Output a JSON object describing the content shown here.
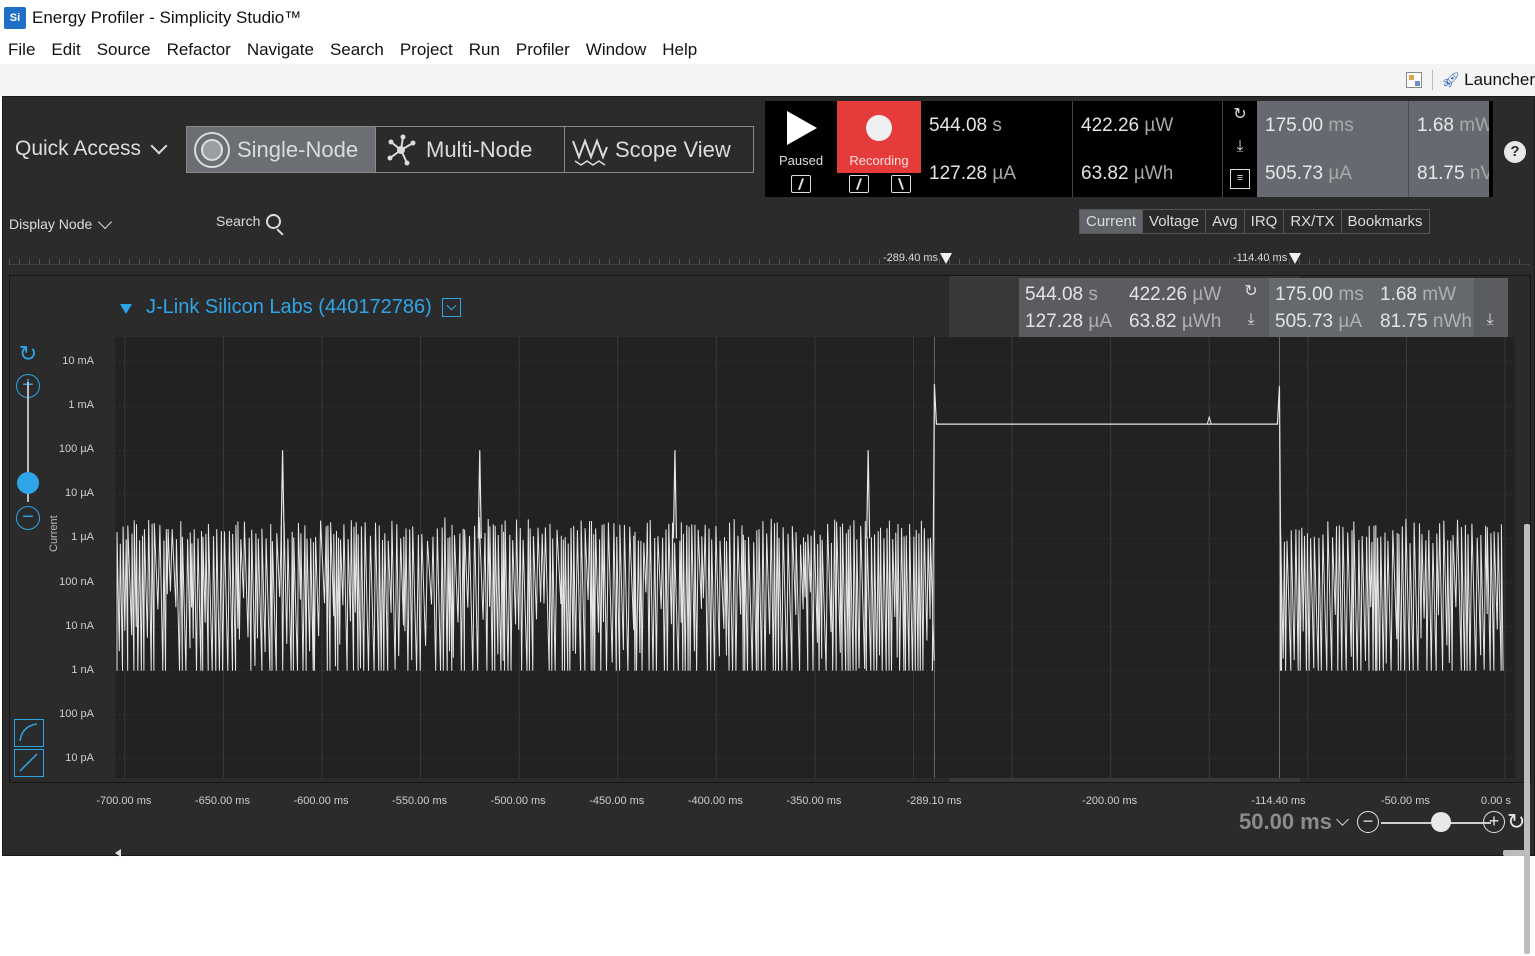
{
  "window": {
    "app_icon": "Si",
    "title": "Energy Profiler - Simplicity Studio™"
  },
  "menu": {
    "items": [
      "File",
      "Edit",
      "Source",
      "Refactor",
      "Navigate",
      "Search",
      "Project",
      "Run",
      "Profiler",
      "Window",
      "Help"
    ]
  },
  "toolbar": {
    "launcher_label": "Launcher",
    "icons": [
      "perspective-icon",
      "rocket-icon"
    ]
  },
  "profiler": {
    "quick_access": "Quick Access",
    "modes": [
      {
        "label": "Single-Node",
        "icon": "single-node-icon",
        "active": true
      },
      {
        "label": "Multi-Node",
        "icon": "multi-node-icon",
        "active": false
      },
      {
        "label": "Scope View",
        "icon": "scope-view-icon",
        "active": false
      }
    ],
    "play_label": "Paused",
    "record_label": "Recording",
    "record_color": "#e53b3b",
    "totals": {
      "time_value": "544.08",
      "time_unit": "s",
      "current_value": "127.28",
      "current_unit": "µA",
      "power_value": "422.26",
      "power_unit": "µW",
      "energy_value": "63.82",
      "energy_unit": "µWh"
    },
    "selection": {
      "duration_value": "175.00",
      "duration_unit": "ms",
      "current_value": "505.73",
      "current_unit": "µA",
      "power_value": "1.68",
      "power_unit": "mW",
      "energy_value": "81.75",
      "energy_unit": "nWh"
    },
    "selection_partial": {
      "power_unit": "mW",
      "energy_unit": "nV"
    },
    "display_node_label": "Display Node",
    "search_label": "Search",
    "view_tabs": [
      {
        "label": "Current",
        "active": true
      },
      {
        "label": "Voltage",
        "active": false
      },
      {
        "label": "Avg",
        "active": false
      },
      {
        "label": "IRQ",
        "active": false
      },
      {
        "label": "RX/TX",
        "active": false
      },
      {
        "label": "Bookmarks",
        "active": false
      }
    ],
    "markers": [
      {
        "label": "-289.40 ms"
      },
      {
        "label": "-114.40 ms"
      }
    ],
    "node_name": "J-Link Silicon Labs (440172786)",
    "accent_color": "#2ea5e8",
    "x_scale": "50.00 ms"
  },
  "chart_data": {
    "type": "line",
    "ylabel": "Current",
    "yscale": "log",
    "y_ticks": [
      "10 mA",
      "1 mA",
      "100 µA",
      "10 µA",
      "1 µA",
      "100 nA",
      "10 nA",
      "1 nA",
      "100 pA",
      "10 pA"
    ],
    "x_ticks": [
      "-700.00 ms",
      "-650.00 ms",
      "-600.00 ms",
      "-550.00 ms",
      "-500.00 ms",
      "-450.00 ms",
      "-400.00 ms",
      "-350.00 ms",
      "-289.10 ms",
      "-200.00 ms",
      "-114.40 ms",
      "-50.00 ms",
      "0.00 s"
    ],
    "xlim_ms": [
      -705,
      0
    ],
    "ylim": [
      "10 pA",
      "10 mA"
    ],
    "selection_ms": [
      -289.4,
      -114.4
    ],
    "baseline_current": "1 nA",
    "pulse_current": "1 µA",
    "spikes": [
      {
        "x_ms": -620,
        "current": "100 µA"
      },
      {
        "x_ms": -520,
        "current": "100 µA"
      },
      {
        "x_ms": -421,
        "current": "100 µA"
      },
      {
        "x_ms": -323,
        "current": "100 µA"
      }
    ],
    "active_window": {
      "x_ms": [
        -289.4,
        -114.4
      ],
      "level": "500 µA",
      "edge_peak": "2 mA"
    }
  }
}
